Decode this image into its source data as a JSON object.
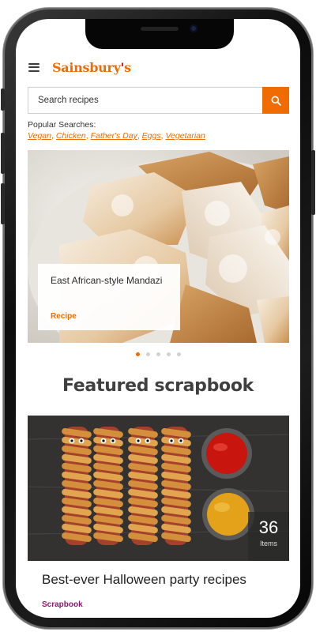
{
  "header": {
    "brand": "Sainsbury's",
    "menu_icon": "hamburger-icon",
    "brand_color": "#f06c00",
    "brand_apostrophe_color": "#e0001b"
  },
  "search": {
    "placeholder": "Search recipes",
    "button_icon": "search-icon"
  },
  "popular": {
    "label": "Popular Searches:",
    "links": [
      "Vegan",
      "Chicken",
      "Father's Day",
      "Eggs",
      "Vegetarian"
    ]
  },
  "hero": {
    "title": "East African-style Mandazi",
    "tag": "Recipe",
    "dots_count": 5,
    "active_dot": 0
  },
  "featured": {
    "heading": "Featured scrapbook",
    "card_title": "Best-ever Halloween party recipes",
    "card_tag": "Scrapbook",
    "count": "36",
    "count_label": "Items"
  },
  "colors": {
    "accent": "#f06c00",
    "scrapbook_tag": "#8a1a6d"
  }
}
